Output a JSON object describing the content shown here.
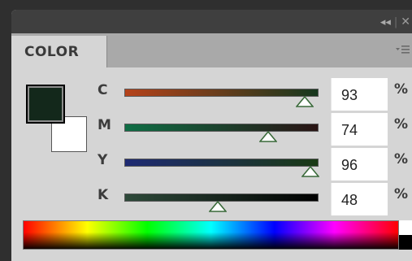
{
  "panel": {
    "tab_label": "COLOR",
    "collapse_icon": "double-chevron-left-icon",
    "close_icon": "close-icon",
    "menu_icon": "panel-menu-icon",
    "title_separator": "|"
  },
  "swatches": {
    "foreground_color": "#13281b",
    "background_color": "#ffffff"
  },
  "channels": [
    {
      "label": "C",
      "value": "93",
      "unit": "%",
      "slider_position": 0.93,
      "gradient": [
        "#b5421a",
        "#16381e"
      ]
    },
    {
      "label": "M",
      "value": "74",
      "unit": "%",
      "slider_position": 0.74,
      "gradient": [
        "#0f6e45",
        "#2a1414"
      ]
    },
    {
      "label": "Y",
      "value": "96",
      "unit": "%",
      "slider_position": 0.96,
      "gradient": [
        "#1e2a73",
        "#1a3a14"
      ]
    },
    {
      "label": "K",
      "value": "48",
      "unit": "%",
      "slider_position": 0.48,
      "gradient": [
        "#2e4a3a",
        "#000000"
      ]
    }
  ]
}
